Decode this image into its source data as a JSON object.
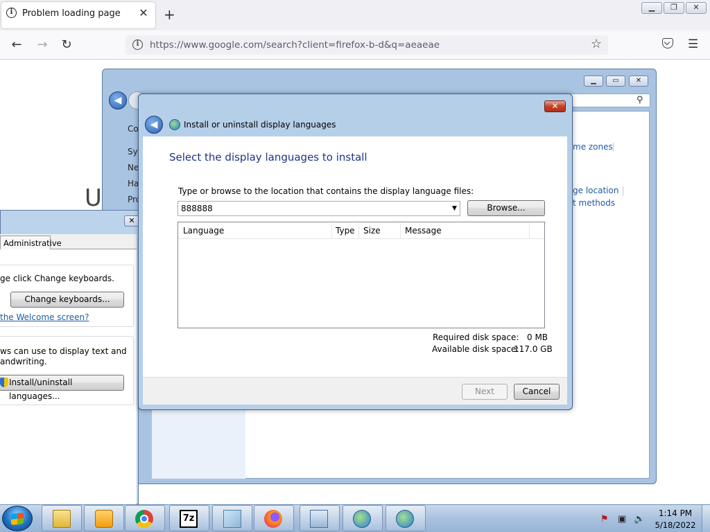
{
  "browser": {
    "tab_title": "Problem loading page",
    "tab_close": "✕",
    "new_tab": "+",
    "url": "https://www.google.com/search?client=firefox-b-d&q=aeaeae",
    "info_glyph": "i"
  },
  "page": {
    "partial_heading": "U"
  },
  "control_panel": {
    "sidebar": [
      "Co",
      "Sys",
      "Ne",
      "Ha",
      "Pro"
    ],
    "links": [
      "me zones",
      "ge location",
      "t methods"
    ]
  },
  "region_language": {
    "tab_administrative": "Administrative",
    "keyboard_text": "ge click Change keyboards.",
    "change_keyboards_button": "Change keyboards...",
    "welcome_link": "the Welcome screen?",
    "display_text_line1": "ws can use to display text and",
    "display_text_line2": "andwriting.",
    "install_button": "Install/uninstall languages..."
  },
  "dialog": {
    "title": "Install or uninstall display languages",
    "heading": "Select the display languages to install",
    "prompt": "Type or browse to the location that contains the display language files:",
    "path_value": "888888",
    "browse_button": "Browse...",
    "columns": [
      "Language",
      "Type",
      "Size",
      "Message"
    ],
    "required_label": "Required disk space:",
    "required_value": "0 MB",
    "available_label": "Available disk space:",
    "available_value": "117.0 GB",
    "next_button": "Next",
    "cancel_button": "Cancel"
  },
  "taskbar": {
    "sevenzip_label": "7z",
    "time": "1:14 PM",
    "date": "5/18/2022"
  },
  "colors": {
    "dialog_heading": "#1e3287",
    "link": "#1e5aa8",
    "taskbar": "#a9c1de"
  }
}
